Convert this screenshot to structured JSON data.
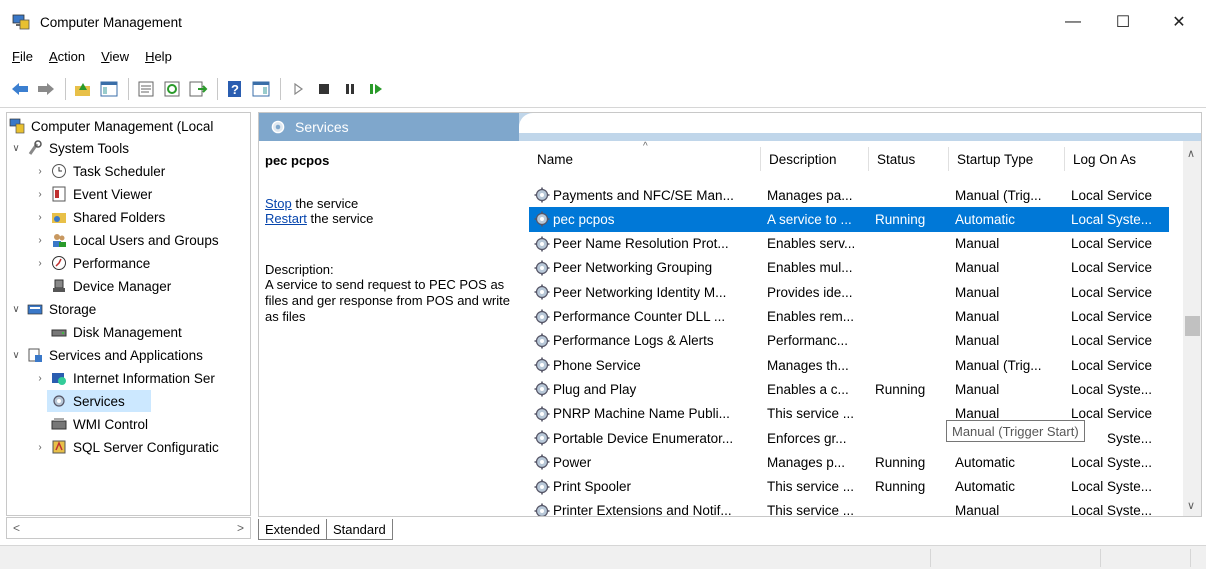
{
  "window": {
    "title": "Computer Management",
    "min": "—",
    "max": "☐",
    "close": "✕"
  },
  "menu": [
    {
      "label": "File",
      "u": "F",
      "rest": "ile"
    },
    {
      "label": "Action",
      "u": "A",
      "rest": "ction"
    },
    {
      "label": "View",
      "u": "V",
      "rest": "iew"
    },
    {
      "label": "Help",
      "u": "H",
      "rest": "elp"
    }
  ],
  "tree": {
    "root": "Computer Management (Local",
    "system_tools": "System Tools",
    "task_scheduler": "Task Scheduler",
    "event_viewer": "Event Viewer",
    "shared_folders": "Shared Folders",
    "local_users": "Local Users and Groups",
    "performance": "Performance",
    "device_manager": "Device Manager",
    "storage": "Storage",
    "disk_management": "Disk Management",
    "services_apps": "Services and Applications",
    "iis": "Internet Information Ser",
    "services": "Services",
    "wmi": "WMI Control",
    "sql": "SQL Server Configuratic"
  },
  "pane": {
    "header": "Services",
    "selected_name": "pec pcpos",
    "stop_link": "Stop",
    "stop_rest": " the service",
    "restart_link": "Restart",
    "restart_rest": " the service",
    "desc_label": "Description:",
    "desc_text": "A service to send request to PEC POS as files and ger response from POS and write as files"
  },
  "columns": {
    "name": "Name",
    "description": "Description",
    "status": "Status",
    "startup": "Startup Type",
    "logon": "Log On As"
  },
  "rows": [
    {
      "name": "Payments and NFC/SE Man...",
      "desc": "Manages pa...",
      "status": "",
      "startup": "Manual (Trig...",
      "logon": "Local Service"
    },
    {
      "name": "pec pcpos",
      "desc": "A service to ...",
      "status": "Running",
      "startup": "Automatic",
      "logon": "Local Syste..."
    },
    {
      "name": "Peer Name Resolution Prot...",
      "desc": "Enables serv...",
      "status": "",
      "startup": "Manual",
      "logon": "Local Service"
    },
    {
      "name": "Peer Networking Grouping",
      "desc": "Enables mul...",
      "status": "",
      "startup": "Manual",
      "logon": "Local Service"
    },
    {
      "name": "Peer Networking Identity M...",
      "desc": "Provides ide...",
      "status": "",
      "startup": "Manual",
      "logon": "Local Service"
    },
    {
      "name": "Performance Counter DLL ...",
      "desc": "Enables rem...",
      "status": "",
      "startup": "Manual",
      "logon": "Local Service"
    },
    {
      "name": "Performance Logs & Alerts",
      "desc": "Performanc...",
      "status": "",
      "startup": "Manual",
      "logon": "Local Service"
    },
    {
      "name": "Phone Service",
      "desc": "Manages th...",
      "status": "",
      "startup": "Manual (Trig...",
      "logon": "Local Service"
    },
    {
      "name": "Plug and Play",
      "desc": "Enables a c...",
      "status": "Running",
      "startup": "Manual",
      "logon": "Local Syste..."
    },
    {
      "name": "PNRP Machine Name Publi...",
      "desc": "This service ...",
      "status": "",
      "startup": "Manual",
      "logon": "Local Service"
    },
    {
      "name": "Portable Device Enumerator...",
      "desc": "Enforces gr...",
      "status": "",
      "startup": "",
      "logon": "Syste..."
    },
    {
      "name": "Power",
      "desc": "Manages p...",
      "status": "Running",
      "startup": "Automatic",
      "logon": "Local Syste..."
    },
    {
      "name": "Print Spooler",
      "desc": "This service ...",
      "status": "Running",
      "startup": "Automatic",
      "logon": "Local Syste..."
    },
    {
      "name": "Printer Extensions and Notif...",
      "desc": "This service ...",
      "status": "",
      "startup": "Manual",
      "logon": "Local Syste..."
    }
  ],
  "tooltip": "Manual (Trigger Start)",
  "tabs": {
    "extended": "Extended",
    "standard": "Standard"
  },
  "colors": {
    "selection": "#0078d7",
    "header_band": "#c0d6ea",
    "header_tab": "#7fa7cc"
  }
}
